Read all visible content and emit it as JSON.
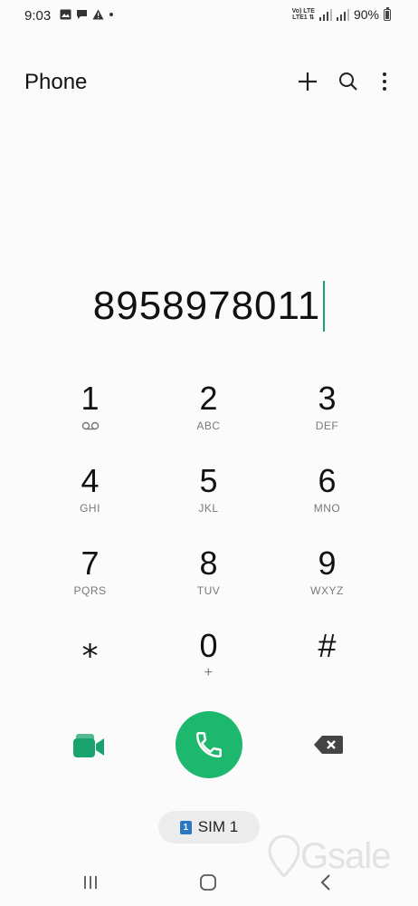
{
  "status_bar": {
    "time": "9:03",
    "lte_top": "Vo) LTE",
    "lte_bottom": "LTE1 ⇅",
    "battery": "90%"
  },
  "app_bar": {
    "title": "Phone",
    "icons": [
      "plus-icon",
      "search-icon",
      "more-vertical-icon"
    ]
  },
  "dial": {
    "number": "8958978011"
  },
  "keypad": [
    {
      "digit": "1",
      "letters": ""
    },
    {
      "digit": "2",
      "letters": "ABC"
    },
    {
      "digit": "3",
      "letters": "DEF"
    },
    {
      "digit": "4",
      "letters": "GHI"
    },
    {
      "digit": "5",
      "letters": "JKL"
    },
    {
      "digit": "6",
      "letters": "MNO"
    },
    {
      "digit": "7",
      "letters": "PQRS"
    },
    {
      "digit": "8",
      "letters": "TUV"
    },
    {
      "digit": "9",
      "letters": "WXYZ"
    },
    {
      "digit": "⁎",
      "letters": ""
    },
    {
      "digit": "0",
      "letters": "+"
    },
    {
      "digit": "#",
      "letters": ""
    }
  ],
  "sim": {
    "badge": "1",
    "label": "SIM 1"
  },
  "watermark": {
    "text": "Gsale"
  },
  "colors": {
    "accent": "#1eb76e",
    "video": "#1aa36e",
    "sim_badge": "#2b77c0"
  }
}
